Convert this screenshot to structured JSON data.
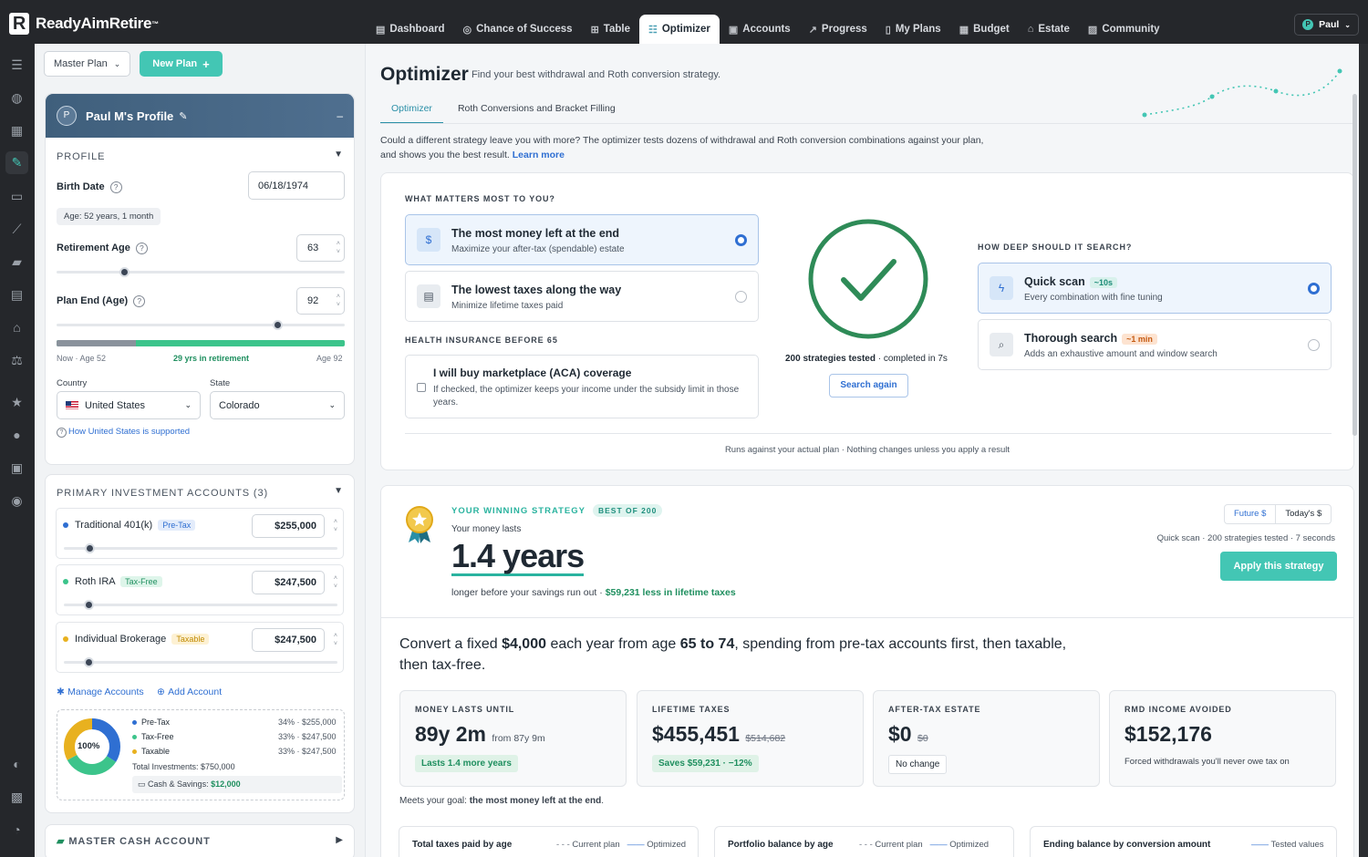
{
  "app": {
    "brand": "ReadyAimRetire",
    "brand_mark": "R",
    "user": "Paul",
    "user_initial": "P"
  },
  "nav": {
    "tabs": [
      {
        "label": "Dashboard",
        "icon": "dashboard-icon"
      },
      {
        "label": "Chance of Success",
        "icon": "target-icon"
      },
      {
        "label": "Table",
        "icon": "table-icon"
      },
      {
        "label": "Optimizer",
        "icon": "sliders-icon",
        "active": true
      },
      {
        "label": "Accounts",
        "icon": "wallet-icon"
      },
      {
        "label": "Progress",
        "icon": "trend-icon"
      },
      {
        "label": "My Plans",
        "icon": "bookmark-icon"
      },
      {
        "label": "Budget",
        "icon": "calculator-icon"
      },
      {
        "label": "Estate",
        "icon": "home-icon"
      },
      {
        "label": "Community",
        "icon": "chat-icon"
      }
    ]
  },
  "plan": {
    "selected": "Master Plan",
    "new_plan": "New Plan"
  },
  "profile": {
    "name": "Paul M's Profile",
    "initial": "P",
    "section": "PROFILE",
    "birth_date_label": "Birth Date",
    "birth_date": "06/18/1974",
    "age_note": "Age: 52 years, 1 month",
    "retirement_age_label": "Retirement Age",
    "retirement_age": "63",
    "plan_end_label": "Plan End (Age)",
    "plan_end": "92",
    "timeline": {
      "start": "Now · Age 52",
      "middle": "29 yrs in retirement",
      "end": "Age 92"
    },
    "country_label": "Country",
    "country": "United States",
    "state_label": "State",
    "state": "Colorado",
    "support_link": "How United States is supported"
  },
  "investments": {
    "title": "PRIMARY INVESTMENT ACCOUNTS (3)",
    "accounts": [
      {
        "name": "Traditional 401(k)",
        "tag": "Pre-Tax",
        "value": "$255,000",
        "color": "#2f6fd2",
        "share": 0.34
      },
      {
        "name": "Roth IRA",
        "tag": "Tax-Free",
        "value": "$247,500",
        "color": "#3cc48b",
        "share": 0.33
      },
      {
        "name": "Individual Brokerage",
        "tag": "Taxable",
        "value": "$247,500",
        "color": "#e8b11f",
        "share": 0.33
      }
    ],
    "manage": "Manage Accounts",
    "add": "Add Account",
    "donut_center": "100%",
    "legend": [
      {
        "label": "Pre-Tax",
        "value": "34% · $255,000"
      },
      {
        "label": "Tax-Free",
        "value": "33% · $247,500"
      },
      {
        "label": "Taxable",
        "value": "33% · $247,500"
      }
    ],
    "total": "Total Investments: $750,000",
    "cash_label": "Cash & Savings:",
    "cash_value": "$12,000"
  },
  "master_cash": "MASTER CASH ACCOUNT",
  "optimizer": {
    "title": "Optimizer",
    "subtitle": "Find your best withdrawal and Roth conversion strategy.",
    "tabs": [
      "Optimizer",
      "Roth Conversions and Bracket Filling"
    ],
    "description": "Could a different strategy leave you with more? The optimizer tests dozens of withdrawal and Roth conversion combinations against your plan, and shows you the best result.",
    "learn_more": "Learn more",
    "matters_title": "WHAT MATTERS MOST TO YOU?",
    "goal_options": [
      {
        "title": "The most money left at the end",
        "desc": "Maximize your after-tax (spendable) estate",
        "selected": true
      },
      {
        "title": "The lowest taxes along the way",
        "desc": "Minimize lifetime taxes paid",
        "selected": false
      }
    ],
    "health_title": "HEALTH INSURANCE BEFORE 65",
    "aca_title": "I will buy marketplace (ACA) coverage",
    "aca_desc": "If checked, the optimizer keeps your income under the subsidy limit in those years.",
    "tested": "200 strategies tested",
    "completed": " · completed in 7s",
    "search_again": "Search again",
    "depth_title": "HOW DEEP SHOULD IT SEARCH?",
    "depth_options": [
      {
        "title": "Quick scan",
        "badge": "~10s",
        "desc": "Every combination with fine tuning",
        "selected": true
      },
      {
        "title": "Thorough search",
        "badge": "~1 min",
        "desc": "Adds an exhaustive amount and window search",
        "selected": false
      }
    ],
    "footnote": "Runs against your actual plan · Nothing changes unless you apply a result"
  },
  "winner": {
    "label": "YOUR WINNING STRATEGY",
    "badge": "BEST OF 200",
    "money_lasts": "Your money lasts",
    "years": "1.4 years",
    "longer": "longer before your savings run out · ",
    "less_taxes": "$59,231 less in lifetime taxes",
    "toggle": [
      "Future $",
      "Today's $"
    ],
    "meta": "Quick scan · 200 strategies tested · 7 seconds",
    "apply": "Apply this strategy",
    "headline_parts": [
      "Convert a fixed ",
      "$4,000",
      " each year from age ",
      "65 to 74",
      ", spending from pre-tax accounts first, then taxable, then tax-free."
    ],
    "stats": [
      {
        "title": "MONEY LASTS UNTIL",
        "value": "89y 2m",
        "sub": "from 87y 9m",
        "chip": "Lasts 1.4 more years"
      },
      {
        "title": "LIFETIME TAXES",
        "value": "$455,451",
        "sub": "$514,682",
        "chip": "Saves $59,231 · −12%"
      },
      {
        "title": "AFTER-TAX ESTATE",
        "value": "$0",
        "sub": "$0",
        "chip": "No change"
      },
      {
        "title": "RMD INCOME AVOIDED",
        "value": "$152,176",
        "sub": "",
        "note": "Forced withdrawals you'll never owe tax on"
      }
    ],
    "goal_note_a": "Meets your goal: ",
    "goal_note_b": "the most money left at the end",
    "goal_note_c": "."
  },
  "charts": [
    {
      "title": "Total taxes paid by age",
      "legend_a": "Current plan",
      "legend_b": "Optimized"
    },
    {
      "title": "Portfolio balance by age",
      "legend_a": "Current plan",
      "legend_b": "Optimized"
    },
    {
      "title": "Ending balance by conversion amount",
      "legend_b": "Tested values"
    }
  ],
  "colors": {
    "accent": "#43c6b4",
    "blue": "#2f6fd2",
    "green": "#2e8b57",
    "teal": "#2a8fa7"
  }
}
